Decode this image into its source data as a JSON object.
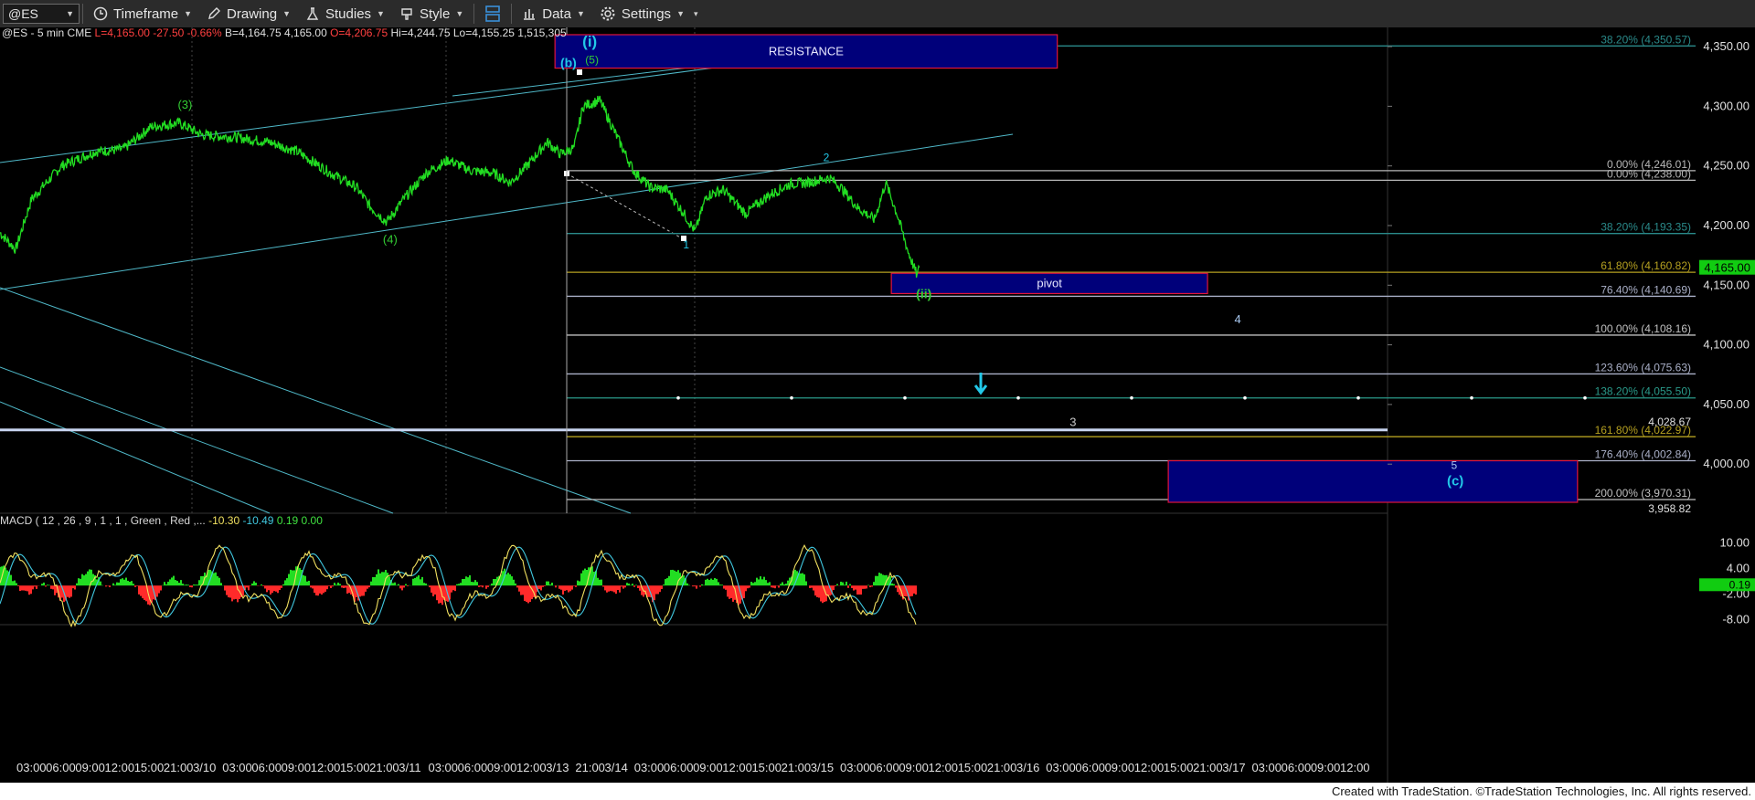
{
  "toolbar": {
    "symbol": "@ES",
    "items": [
      {
        "id": "timeframe",
        "label": "Timeframe",
        "icon": "clock-icon"
      },
      {
        "id": "drawing",
        "label": "Drawing",
        "icon": "pencil-icon"
      },
      {
        "id": "studies",
        "label": "Studies",
        "icon": "flask-icon"
      },
      {
        "id": "style",
        "label": "Style",
        "icon": "palette-icon"
      },
      {
        "id": "layout",
        "label": "",
        "icon": "layout-icon"
      },
      {
        "id": "data",
        "label": "Data",
        "icon": "bar-chart-icon"
      },
      {
        "id": "settings",
        "label": "Settings",
        "icon": "gear-icon"
      }
    ]
  },
  "footer": {
    "text": "Created with TradeStation. ©TradeStation Technologies, Inc. All rights reserved."
  },
  "chart_data": {
    "type": "line",
    "header": {
      "symbol": "@ES - 5 min",
      "exchange": "CME",
      "last": "L=4,165.00",
      "change": "-27.50",
      "change_pct": "-0.66%",
      "bid": "B=4,164.75",
      "ask": "4,165.00",
      "open": "O=4,206.75",
      "high": "Hi=4,244.75",
      "low": "Lo=4,155.25",
      "volume": "1,515,305"
    },
    "colors": {
      "price": "#22dd22",
      "down": "#ff2a2a",
      "fib": "#9aa0aa",
      "trend": "#4fb8c8",
      "box_fill": "#00007a",
      "box_border": "#e0143c",
      "label_green": "#33cc33",
      "label_cyan": "#22c8e8",
      "last_price_bg": "#11cc11"
    },
    "ylim": [
      3958.82,
      4360
    ],
    "price_ticks": [
      "4,350.00",
      "4,300.00",
      "4,250.00",
      "4,200.00",
      "4,150.00",
      "4,100.00",
      "4,050.00",
      "4,000.00"
    ],
    "last_price_label": "4,165.00",
    "x_ticks": [
      "03:00",
      "06:00",
      "09:00",
      "12:00",
      "15:00",
      "21:00",
      "3/10",
      "03:00",
      "06:00",
      "09:00",
      "12:00",
      "15:00",
      "21:00",
      "3/11",
      "03:00",
      "06:00",
      "09:00",
      "12:00",
      "3/13",
      "21:00",
      "3/14",
      "03:00",
      "06:00",
      "09:00",
      "12:00",
      "15:00",
      "21:00",
      "3/15",
      "03:00",
      "06:00",
      "09:00",
      "12:00",
      "15:00",
      "21:00",
      "3/16",
      "03:00",
      "06:00",
      "09:00",
      "12:00",
      "15:00",
      "21:00",
      "3/17",
      "03:00",
      "06:00",
      "09:00",
      "12:00"
    ],
    "price_anchors": [
      [
        0,
        4194
      ],
      [
        14,
        4180
      ],
      [
        28,
        4222
      ],
      [
        55,
        4250
      ],
      [
        85,
        4262
      ],
      [
        110,
        4264
      ],
      [
        135,
        4283
      ],
      [
        160,
        4286
      ],
      [
        180,
        4276
      ],
      [
        210,
        4274
      ],
      [
        240,
        4270
      ],
      [
        265,
        4262
      ],
      [
        295,
        4244
      ],
      [
        318,
        4232
      ],
      [
        330,
        4216
      ],
      [
        345,
        4203
      ],
      [
        360,
        4222
      ],
      [
        380,
        4244
      ],
      [
        400,
        4255
      ],
      [
        420,
        4246
      ],
      [
        440,
        4244
      ],
      [
        455,
        4236
      ],
      [
        470,
        4250
      ],
      [
        488,
        4270
      ],
      [
        500,
        4260
      ],
      [
        512,
        4265
      ],
      [
        520,
        4300
      ],
      [
        535,
        4305
      ],
      [
        550,
        4275
      ],
      [
        565,
        4246
      ],
      [
        580,
        4232
      ],
      [
        595,
        4230
      ],
      [
        610,
        4210
      ],
      [
        620,
        4195
      ],
      [
        630,
        4225
      ],
      [
        645,
        4230
      ],
      [
        665,
        4210
      ],
      [
        685,
        4225
      ],
      [
        705,
        4235
      ],
      [
        720,
        4236
      ],
      [
        740,
        4240
      ],
      [
        750,
        4232
      ],
      [
        765,
        4215
      ],
      [
        780,
        4205
      ],
      [
        790,
        4236
      ],
      [
        800,
        4210
      ],
      [
        810,
        4178
      ],
      [
        818,
        4158
      ],
      [
        820,
        4165
      ]
    ],
    "fib_levels": [
      {
        "label": "38.20% (4,350.57)",
        "value": 4350.57,
        "color": "#2a8a8a"
      },
      {
        "label": "0.00% (4,246.01)",
        "value": 4246.01,
        "color": "#b8b8b8"
      },
      {
        "label": "0.00% (4,238.00)",
        "value": 4238.0,
        "color": "#b8b8b8"
      },
      {
        "label": "38.20% (4,193.35)",
        "value": 4193.35,
        "color": "#2a8a8a"
      },
      {
        "label": "61.80% (4,160.82)",
        "value": 4160.82,
        "color": "#b5a020"
      },
      {
        "label": "76.40% (4,140.69)",
        "value": 4140.69,
        "color": "#aab0c8"
      },
      {
        "label": "100.00% (4,108.16)",
        "value": 4108.16,
        "color": "#c0c0c0"
      },
      {
        "label": "123.60% (4,075.63)",
        "value": 4075.63,
        "color": "#aab0c8"
      },
      {
        "label": "138.20% (4,055.50)",
        "value": 4055.5,
        "color": "#2a9a8a"
      },
      {
        "label": "161.80% (4,022.97)",
        "value": 4022.97,
        "color": "#b5a020"
      },
      {
        "label": "176.40% (4,002.84)",
        "value": 4002.84,
        "color": "#aab0c8"
      },
      {
        "label": "200.00% (3,970.31)",
        "value": 3970.31,
        "color": "#c0c0c0"
      }
    ],
    "level_4028": {
      "label": "4,028.67",
      "value": 4028.67
    },
    "level_3958": {
      "label": "3,958.82",
      "value": 3958.82
    },
    "boxes": [
      {
        "id": "resistance",
        "label": "RESISTANCE",
        "x0": 495,
        "x1": 943,
        "y_top": 4360,
        "y_bottom": 4332
      },
      {
        "id": "pivot",
        "label": "pivot",
        "x0": 795,
        "x1": 1077,
        "y_top": 4160,
        "y_bottom": 4143
      },
      {
        "id": "target",
        "label": "",
        "x0": 1042,
        "x1": 1407,
        "y_top": 4002.84,
        "y_bottom": 3968
      }
    ],
    "wave_labels": [
      {
        "text": "(i)",
        "x": 526,
        "y": 4350,
        "color": "#22c8e8",
        "size": 17,
        "bold": true
      },
      {
        "text": "(5)",
        "x": 528,
        "y": 4336,
        "color": "#33cc33",
        "size": 12
      },
      {
        "text": "(b)",
        "x": 507,
        "y": 4333,
        "color": "#22c8e8",
        "size": 14,
        "bold": true
      },
      {
        "text": "(3)",
        "x": 165,
        "y": 4298,
        "color": "#33cc33",
        "size": 13
      },
      {
        "text": "(4)",
        "x": 348,
        "y": 4185,
        "color": "#33cc33",
        "size": 13
      },
      {
        "text": "1",
        "x": 612,
        "y": 4181,
        "color": "#22c8e8",
        "size": 12
      },
      {
        "text": "2",
        "x": 737,
        "y": 4254,
        "color": "#22c8e8",
        "size": 12
      },
      {
        "text": "(ii)",
        "x": 824,
        "y": 4139,
        "color": "#33cc33",
        "size": 14,
        "bold": true
      },
      {
        "text": "4",
        "x": 1104,
        "y": 4118,
        "color": "#a8c8f0",
        "size": 13
      },
      {
        "text": "3",
        "x": 957,
        "y": 4032,
        "color": "#c8c8c8",
        "size": 13
      },
      {
        "text": "5",
        "x": 1297,
        "y": 3996,
        "color": "#a8c8f0",
        "size": 12
      },
      {
        "text": "(c)",
        "x": 1298,
        "y": 3982,
        "color": "#22c8e8",
        "size": 15,
        "bold": true
      }
    ],
    "macd": {
      "label": "MACD ( 12 , 26 , 9 , 1 , 1 , Green , Red ,...",
      "values": [
        "-10.30",
        "-10.49",
        "0.19",
        "0.00"
      ],
      "ticks": [
        "10.00",
        "4.00",
        "-2.00",
        "-8.00"
      ],
      "last_label": "0.19",
      "ylim": [
        -10,
        12
      ]
    }
  }
}
